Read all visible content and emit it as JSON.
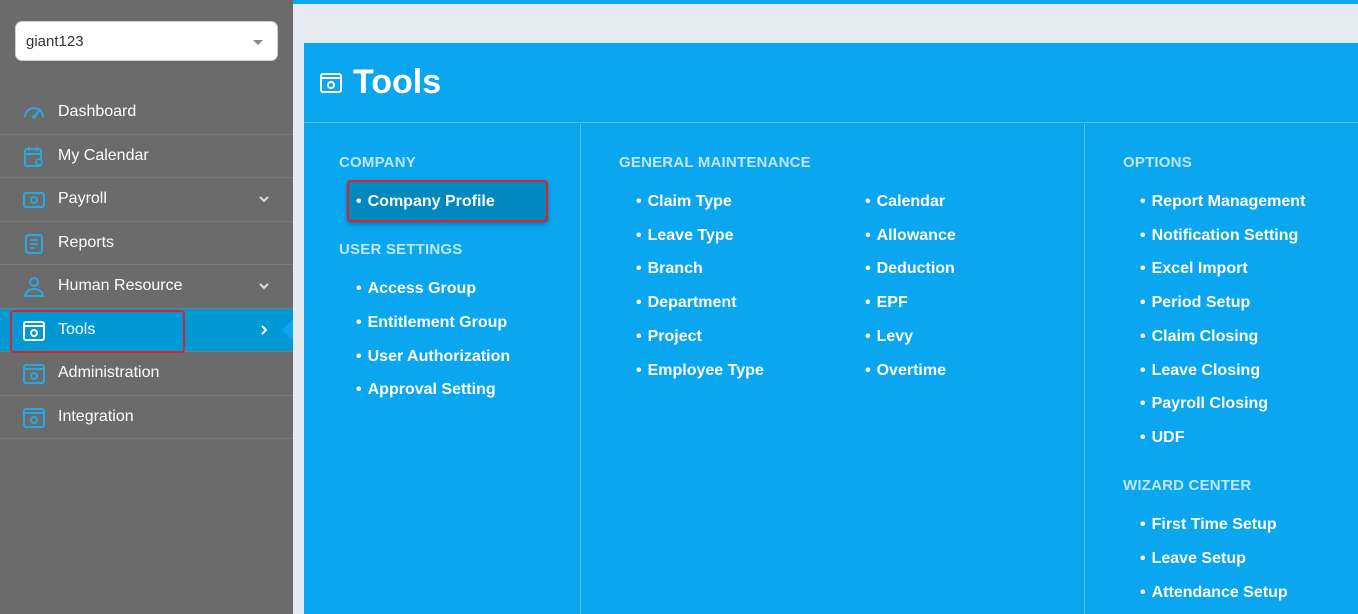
{
  "selector": {
    "value": "giant123"
  },
  "sidebar": {
    "items": [
      {
        "label": "Dashboard",
        "icon": "dashboard-gauge-icon"
      },
      {
        "label": "My Calendar",
        "icon": "calendar-user-icon"
      },
      {
        "label": "Payroll",
        "icon": "payroll-money-icon",
        "expandable": true
      },
      {
        "label": "Reports",
        "icon": "reports-document-icon"
      },
      {
        "label": "Human Resource",
        "icon": "human-resource-icon",
        "expandable": true
      },
      {
        "label": "Tools",
        "icon": "tools-settings-icon",
        "active": true
      },
      {
        "label": "Administration",
        "icon": "administration-icon"
      },
      {
        "label": "Integration",
        "icon": "integration-icon"
      }
    ]
  },
  "panel": {
    "title": "Tools",
    "company": {
      "title": "COMPANY",
      "items": [
        "Company Profile"
      ]
    },
    "user_settings": {
      "title": "USER SETTINGS",
      "items": [
        "Access Group",
        "Entitlement Group",
        "User Authorization",
        "Approval Setting"
      ]
    },
    "general_maintenance": {
      "title": "GENERAL MAINTENANCE",
      "col1": [
        "Claim Type",
        "Leave Type",
        "Branch",
        "Department",
        "Project",
        "Employee Type"
      ],
      "col2": [
        "Calendar",
        "Allowance",
        "Deduction",
        "EPF",
        "Levy",
        "Overtime"
      ]
    },
    "options": {
      "title": "OPTIONS",
      "items": [
        "Report Management",
        "Notification Setting",
        "Excel Import",
        "Period Setup",
        "Claim Closing",
        "Leave Closing",
        "Payroll Closing",
        "UDF"
      ]
    },
    "wizard_center": {
      "title": "WIZARD CENTER",
      "items": [
        "First Time Setup",
        "Leave Setup",
        "Attendance Setup"
      ]
    }
  },
  "colors": {
    "sidebar_bg": "#6b6b6b",
    "accent": "#0aa6f0",
    "active_item": "#0099d6",
    "highlight_border": "#d9232e",
    "section_title": "#bfe6fb"
  }
}
